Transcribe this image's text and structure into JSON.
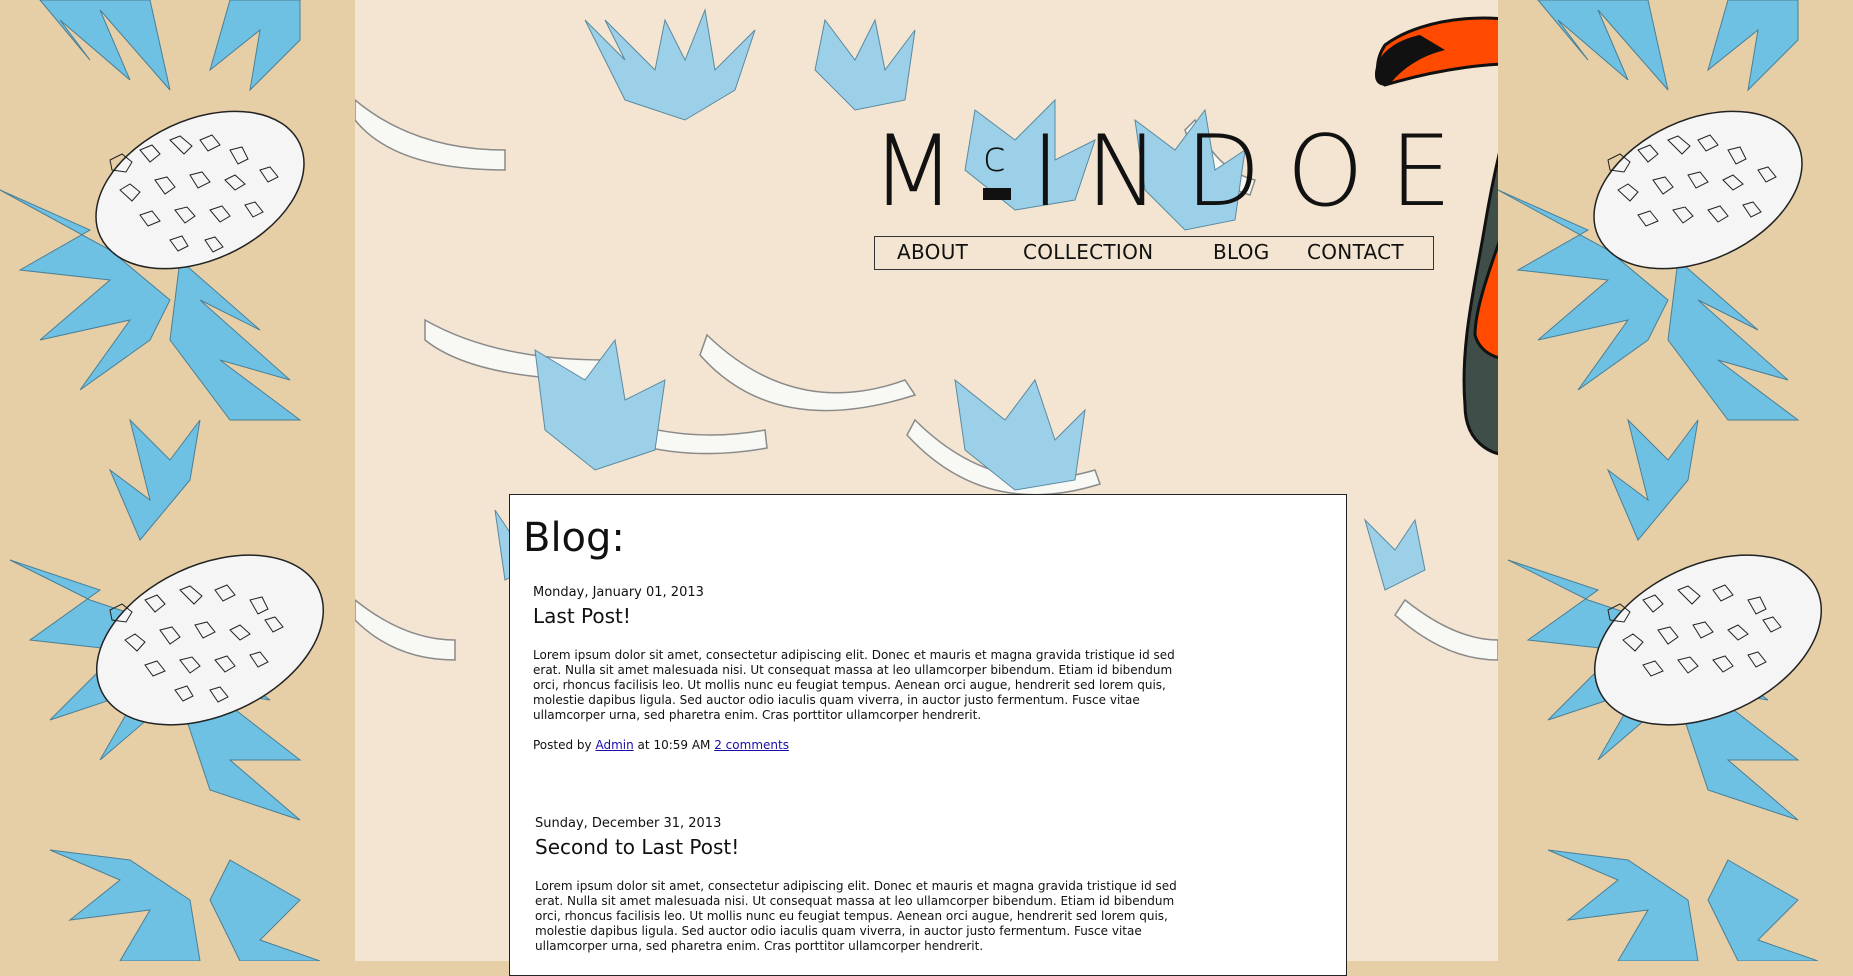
{
  "brand": {
    "logo_main": "M",
    "logo_superscript": "c",
    "logo_rest": "INDOE"
  },
  "nav": {
    "items": [
      {
        "label": "ABOUT"
      },
      {
        "label": "COLLECTION"
      },
      {
        "label": "BLOG"
      },
      {
        "label": "CONTACT"
      }
    ]
  },
  "blog": {
    "heading": "Blog:",
    "posts": [
      {
        "date": "Monday, January 01, 2013",
        "title": "Last Post!",
        "body": "Lorem ipsum dolor sit amet, consectetur adipiscing elit. Donec et mauris et magna gravida tristique id sed erat. Nulla sit amet malesuada nisi. Ut consequat massa at leo ullamcorper bibendum. Etiam id bibendum orci, rhoncus facilisis leo. Ut mollis nunc eu feugiat tempus. Aenean orci augue, hendrerit sed lorem quis, molestie dapibus ligula. Sed auctor odio iaculis quam viverra, in auctor justo fermentum. Fusce vitae ullamcorper urna, sed pharetra enim. Cras porttitor ullamcorper hendrerit.",
        "posted_by_prefix": "Posted by",
        "author": "Admin",
        "at_label": "at",
        "time": "10:59 AM",
        "comments": "2 comments"
      },
      {
        "date": "Sunday, December 31, 2013",
        "title": "Second to Last Post!",
        "body": "Lorem ipsum dolor sit amet, consectetur adipiscing elit. Donec et mauris et magna gravida tristique id sed erat. Nulla sit amet malesuada nisi. Ut consequat massa at leo ullamcorper bibendum. Etiam id bibendum orci, rhoncus facilisis leo. Ut mollis nunc eu feugiat tempus. Aenean orci augue, hendrerit sed lorem quis, molestie dapibus ligula. Sed auctor odio iaculis quam viverra, in auctor justo fermentum. Fusce vitae ullamcorper urna, sed pharetra enim. Cras porttitor ullamcorper hendrerit."
      }
    ]
  },
  "colors": {
    "side_bg": "#e6cfa6",
    "center_bg": "#f3e5d2",
    "leaf_blue": "#6fc1e3",
    "toucan_orange": "#ff4a00",
    "toucan_body": "#3f4e48",
    "link": "#1a0dab"
  }
}
